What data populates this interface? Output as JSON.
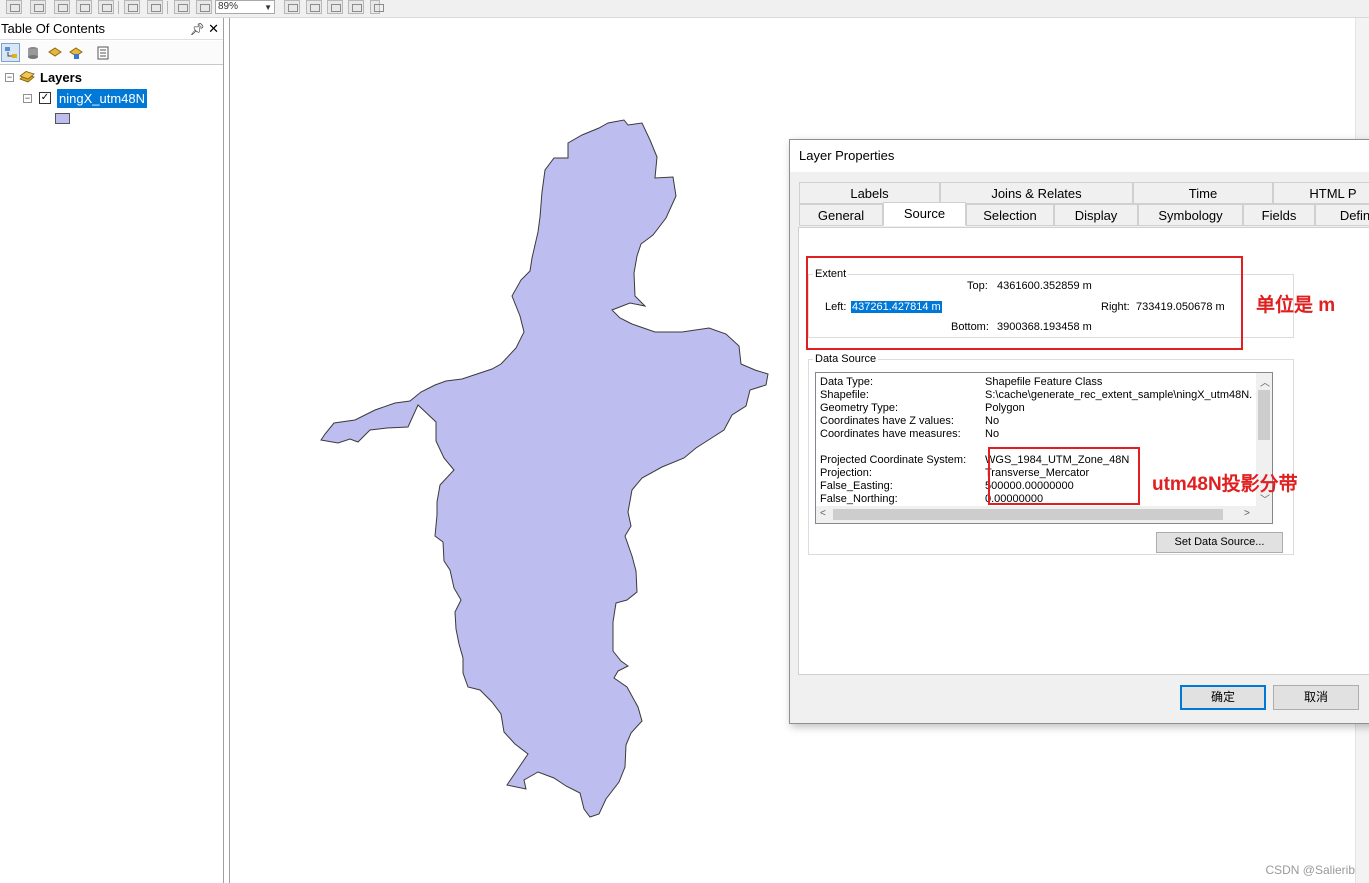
{
  "toolbar": {
    "zoom_value": "89%"
  },
  "toc": {
    "title": "Table Of Contents",
    "root_label": "Layers",
    "layer_name": "ningX_utm48N",
    "legend_color": "#bebdf0"
  },
  "map": {
    "fill_color": "#bebdf0",
    "watermark": "CSDN @Salierib"
  },
  "dialog": {
    "title": "Layer Properties",
    "tabs_row1": [
      "Labels",
      "Joins & Relates",
      "Time",
      "HTML P"
    ],
    "tabs_row2": [
      "General",
      "Source",
      "Selection",
      "Display",
      "Symbology",
      "Fields",
      "Defin"
    ],
    "active_tab": "Source",
    "extent": {
      "legend": "Extent",
      "top_label": "Top:",
      "top_value": "4361600.352859 m",
      "left_label": "Left:",
      "left_value": "437261.427814 m",
      "right_label": "Right:",
      "right_value": "733419.050678 m",
      "bottom_label": "Bottom:",
      "bottom_value": "3900368.193458 m"
    },
    "data_source": {
      "legend": "Data Source",
      "rows": [
        {
          "key": "Data Type:",
          "value": "Shapefile Feature Class"
        },
        {
          "key": "Shapefile:",
          "value": "S:\\cache\\generate_rec_extent_sample\\ningX_utm48N."
        },
        {
          "key": "Geometry Type:",
          "value": "Polygon"
        },
        {
          "key": "Coordinates have Z values:",
          "value": "No"
        },
        {
          "key": "Coordinates have measures:",
          "value": "No"
        },
        {
          "key": "",
          "value": ""
        },
        {
          "key": "Projected Coordinate System:",
          "value": "WGS_1984_UTM_Zone_48N"
        },
        {
          "key": "Projection:",
          "value": "Transverse_Mercator"
        },
        {
          "key": "False_Easting:",
          "value": "500000.00000000"
        },
        {
          "key": "False_Northing:",
          "value": "0.00000000"
        }
      ],
      "set_button": "Set Data Source..."
    },
    "ok_button": "确定",
    "cancel_button": "取消"
  },
  "annotations": {
    "units_note": "单位是 m",
    "projection_note": "utm48N投影分带",
    "color": "#e02020"
  }
}
